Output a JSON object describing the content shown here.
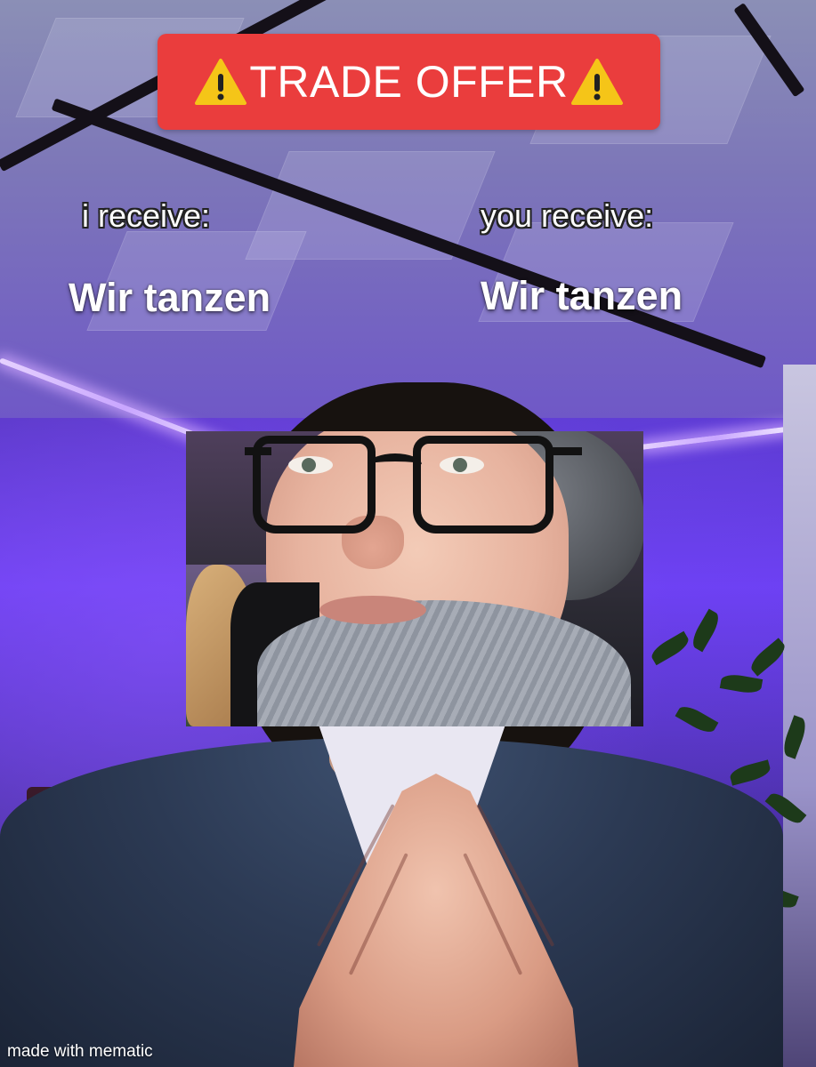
{
  "banner": {
    "warning_icon": "warning-triangle-icon",
    "title": "TRADE OFFER",
    "color": "#ea3d3d",
    "icon_color": "#f5c518"
  },
  "left_column": {
    "label": "i receive:",
    "item": "Wir tanzen"
  },
  "right_column": {
    "label": "you receive:",
    "item": "Wir tanzen"
  },
  "watermark": "made with mematic"
}
